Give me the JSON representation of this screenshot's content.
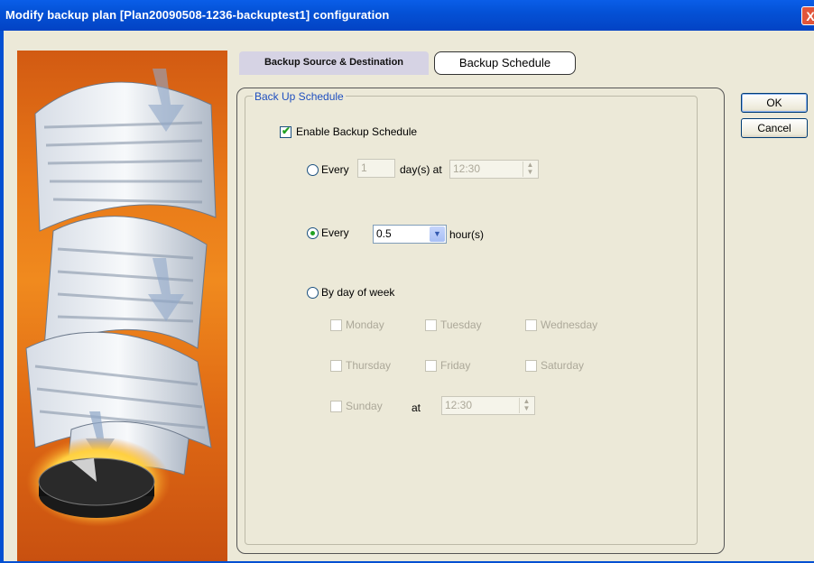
{
  "window": {
    "title": "Modify backup plan [Plan20090508-1236-backuptest1] configuration",
    "close_label": "X"
  },
  "tabs": [
    {
      "label": "Backup Source & Destination",
      "active": false
    },
    {
      "label": "Backup Schedule",
      "active": true
    }
  ],
  "schedule": {
    "group_title": "Back Up Schedule",
    "enable_label": "Enable Backup Schedule",
    "enable_checked": true,
    "daily": {
      "prefix": "Every",
      "days_value": "1",
      "suffix": "day(s) at",
      "time_value": "12:30",
      "selected": false
    },
    "hourly": {
      "prefix": "Every",
      "interval_value": "0.5",
      "suffix": "hour(s)",
      "selected": true
    },
    "weekly": {
      "label": "By day of week",
      "selected": false,
      "days": [
        "Monday",
        "Tuesday",
        "Wednesday",
        "Thursday",
        "Friday",
        "Saturday",
        "Sunday"
      ],
      "at_label": "at",
      "time_value": "12:30"
    }
  },
  "buttons": {
    "ok": "OK",
    "cancel": "Cancel"
  },
  "colors": {
    "title_bar": "#0451d6",
    "accent_check": "#21a121",
    "legend": "#1f4fbf",
    "side_panel": "#e87818"
  }
}
